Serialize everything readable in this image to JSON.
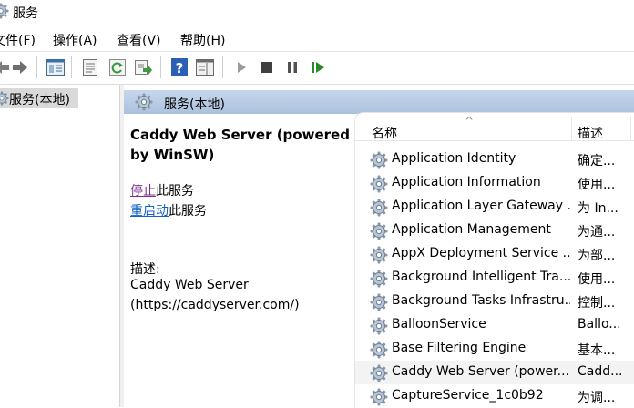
{
  "window": {
    "title": "服务"
  },
  "menu": [
    {
      "label": "文件(F)"
    },
    {
      "label": "操作(A)"
    },
    {
      "label": "查看(V)"
    },
    {
      "label": "帮助(H)"
    }
  ],
  "toolbar": {
    "icons": [
      "back-arrow-icon",
      "forward-arrow-icon",
      "show-tree-icon",
      "properties-icon",
      "refresh-icon",
      "export-list-icon",
      "help-icon",
      "show-action-pane-icon",
      "start-service-icon",
      "stop-service-icon",
      "pause-service-icon",
      "resume-service-icon"
    ]
  },
  "tree": {
    "selected_label": "服务(本地)"
  },
  "main": {
    "header_label": "服务(本地)",
    "detail": {
      "service_title": "Caddy Web Server (powered by WinSW)",
      "stop_link": "停止",
      "stop_suffix": "此服务",
      "restart_link": "重启动",
      "restart_suffix": "此服务",
      "desc_label": "描述:",
      "desc_line1": "Caddy Web Server",
      "desc_line2": "(https://caddyserver.com/)"
    },
    "list": {
      "col_name": "名称",
      "sort_arrow": "^",
      "col_desc": "描述",
      "rows": [
        {
          "name": "Application Identity",
          "desc": "确定..."
        },
        {
          "name": "Application Information",
          "desc": "使用..."
        },
        {
          "name": "Application Layer Gateway ...",
          "desc": "为 In..."
        },
        {
          "name": "Application Management",
          "desc": "为通..."
        },
        {
          "name": "AppX Deployment Service ...",
          "desc": "为部..."
        },
        {
          "name": "Background Intelligent Tra...",
          "desc": "使用..."
        },
        {
          "name": "Background Tasks Infrastru...",
          "desc": "控制..."
        },
        {
          "name": "BalloonService",
          "desc": "Ballo..."
        },
        {
          "name": "Base Filtering Engine",
          "desc": "基本..."
        },
        {
          "name": "Caddy Web Server (power...",
          "desc": "Cadd..."
        },
        {
          "name": "CaptureService_1c0b92",
          "desc": "为调..."
        }
      ]
    }
  }
}
